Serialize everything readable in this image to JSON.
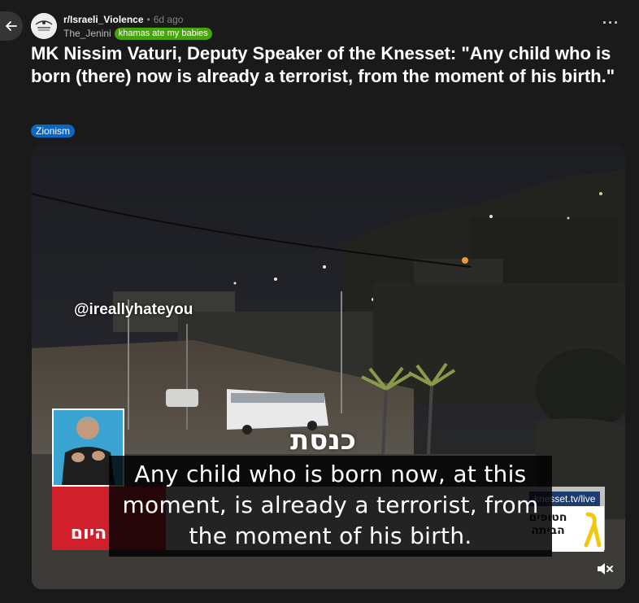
{
  "post": {
    "subreddit": "r/Israeli_Violence",
    "separator": "•",
    "time_ago": "6d ago",
    "author": "The_Jenini",
    "user_flair": "khamas ate my babies",
    "title": "MK Nissim Vaturi, Deputy Speaker of the Knesset: \"Any child who is born (there) now is already a terrorist, from the moment of his birth.\"",
    "post_flair": "Zionism",
    "more_label": "···"
  },
  "video": {
    "watermark": "@ireallyhateyou",
    "channel_logo": "כנסת",
    "red_banner_text": "היום",
    "subtitle": "Any child who is born now, at this moment, is already a terrorist, from the moment of his birth.",
    "site_url": "knesset.tv/live",
    "right_logo_text": "חטופים הביתה",
    "mute_icon": "speaker-muted-icon"
  },
  "icons": {
    "back": "arrow-left-icon",
    "avatar": "subreddit-avatar-icon",
    "more": "more-horizontal-icon"
  },
  "colors": {
    "background": "#1a1a1b",
    "user_flair_bg": "#46a508",
    "post_flair_bg": "#0a66c2",
    "banner_red": "#d0202c"
  }
}
